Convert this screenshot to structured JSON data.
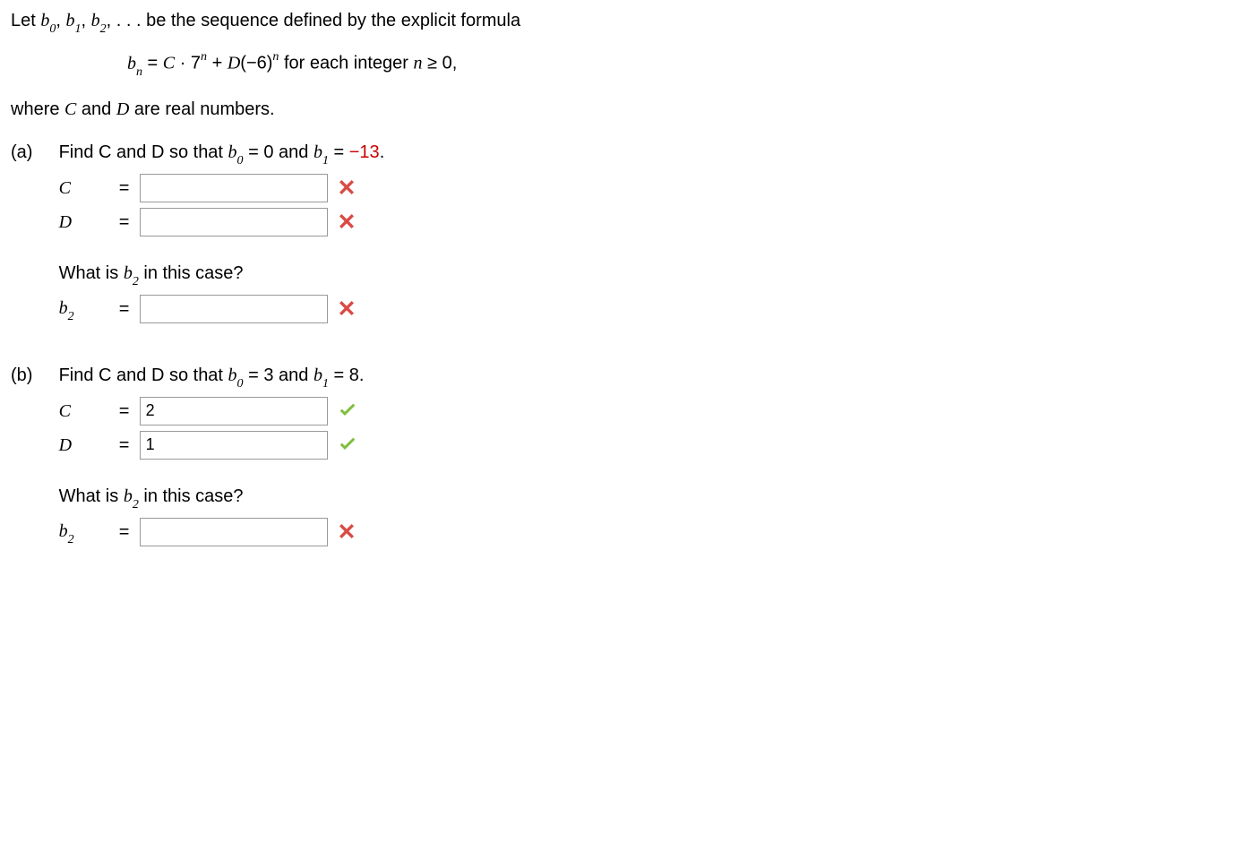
{
  "intro": {
    "let_prefix": "Let ",
    "seq_tail_text": " be the sequence defined by the explicit formula",
    "formula_tail": " for each integer ",
    "where_line": "where ",
    "and_word": " and ",
    "are_real": " are real numbers."
  },
  "vars": {
    "b": "b",
    "C": "C",
    "D": "D",
    "n": "n",
    "eq": " = ",
    "dot": " · ",
    "plus": " + ",
    "seven": "7",
    "neg6": "(−6)",
    "ge0": " ≥ 0,",
    "ellipsis": ", . . ."
  },
  "part_a": {
    "label": "(a)",
    "prompt_text": "Find C and D so that ",
    "b0_eq": " = 0 and ",
    "b1_val": "−13",
    "period": ".",
    "C_label": "C",
    "D_label": "D",
    "eq_sym": "=",
    "C_value": "",
    "D_value": "",
    "b2_prompt": "What is ",
    "b2_tail": " in this case?",
    "b2_label": "b",
    "b2_value": ""
  },
  "part_b": {
    "label": "(b)",
    "prompt_text": "Find C and D so that ",
    "b0_eq": " = 3 and ",
    "b1_val": "8",
    "period": ".",
    "C_label": "C",
    "D_label": "D",
    "eq_sym": "=",
    "C_value": "2",
    "D_value": "1",
    "b2_prompt": "What is ",
    "b2_tail": " in this case?",
    "b2_label": "b",
    "b2_value": ""
  },
  "subs": {
    "zero": "0",
    "one": "1",
    "two": "2"
  }
}
